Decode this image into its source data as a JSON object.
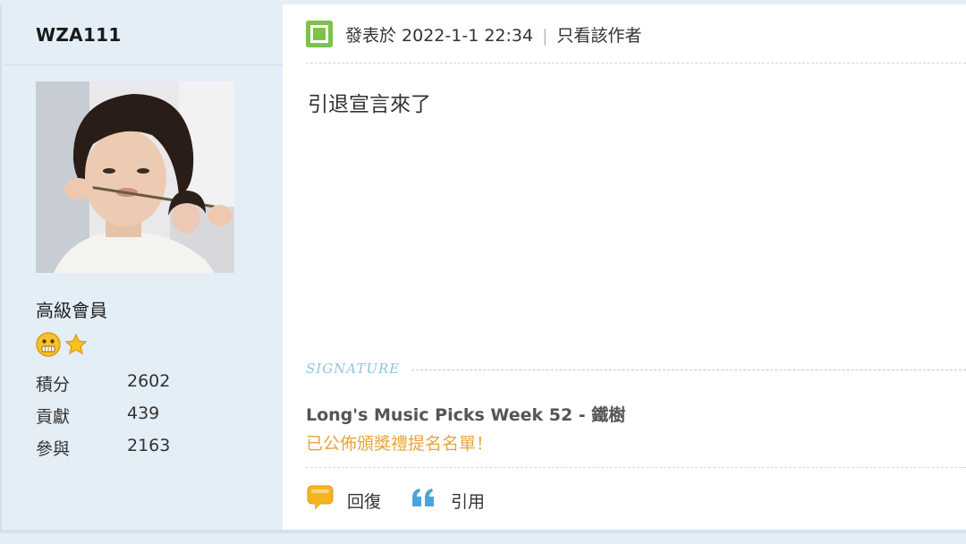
{
  "user": {
    "name": "WZA111",
    "rank": "高級會員",
    "stats": [
      {
        "label": "積分",
        "value": "2602"
      },
      {
        "label": "貢獻",
        "value": "439"
      },
      {
        "label": "參與",
        "value": "2163"
      }
    ]
  },
  "post": {
    "posted_on": "發表於 2022-1-1 22:34",
    "only_author": "只看該作者",
    "content": "引退宣言來了"
  },
  "signature": {
    "label": "SIGNATURE",
    "title": "Long's Music Picks Week 52 - 鐵樹",
    "subtitle": "已公佈頒獎禮提名名單！"
  },
  "actions": {
    "reply": "回復",
    "quote": "引用"
  },
  "icons": {
    "post_icon": "post-status-icon",
    "reply_icon": "speech-bubble-icon",
    "quote_icon": "quote-marks-icon",
    "rank_icons": [
      "smiley-icon",
      "star-icon"
    ]
  },
  "colors": {
    "sidebar_bg": "#e4eef7",
    "signature_label": "#8ec6de",
    "signature_subtitle": "#e8a53a",
    "post_icon": "#7dc24b",
    "quote_icon": "#4aa6d8",
    "reply_icon": "#f0b51e"
  }
}
